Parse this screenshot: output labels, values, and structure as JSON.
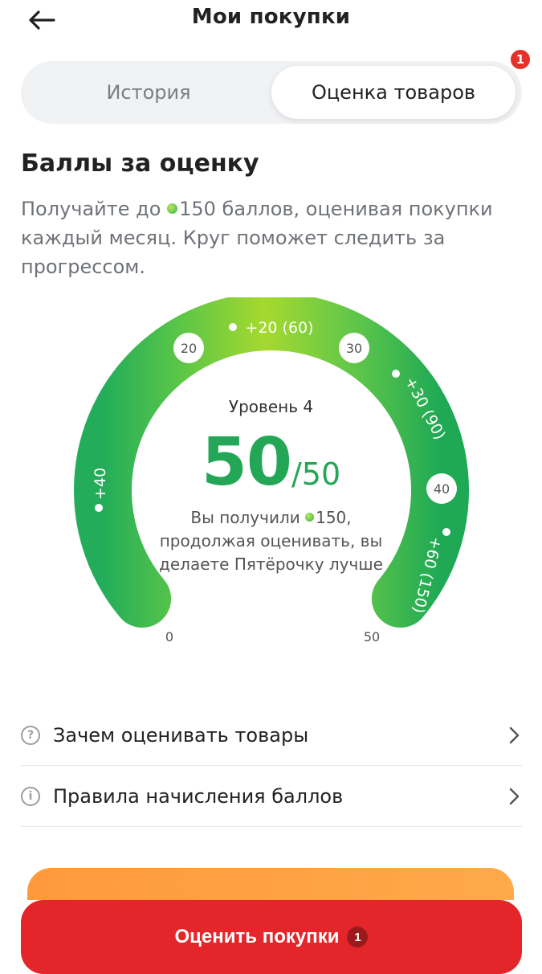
{
  "header": {
    "title": "Мои покупки",
    "back_icon": "arrow-left-icon"
  },
  "tabs": {
    "history_label": "История",
    "rating_label": "Оценка товаров",
    "badge": "1",
    "active": "rating"
  },
  "section": {
    "title": "Баллы за оценку",
    "desc_prefix": "Получайте до",
    "desc_points": "150",
    "desc_suffix": "баллов, оценивая покупки каждый месяц. Круг поможет следить за прогрессом."
  },
  "gauge": {
    "level": "Уровень 4",
    "score": "50",
    "score_max": "/50",
    "progress": 1.0,
    "note_prefix": "Вы получили",
    "note_points": "150,",
    "note_suffix": "продолжая оценивать, вы делаете Пятёрочку лучше",
    "milestones": [
      "0",
      "20",
      "30",
      "40",
      "50"
    ],
    "rewards": [
      "+40",
      "+20 (60)",
      "+30 (90)",
      "+60 (150)"
    ],
    "colors": {
      "start": "#23ad5a",
      "mid": "#a6d92f",
      "end": "#1fa955"
    }
  },
  "rows": [
    {
      "label": "Зачем оценивать товары",
      "icon": "question-circle-icon"
    },
    {
      "label": "Правила начисления баллов",
      "icon": "info-circle-icon"
    }
  ],
  "cta": {
    "label": "Оценить покупки",
    "badge": "1",
    "color": "#e4262a"
  }
}
